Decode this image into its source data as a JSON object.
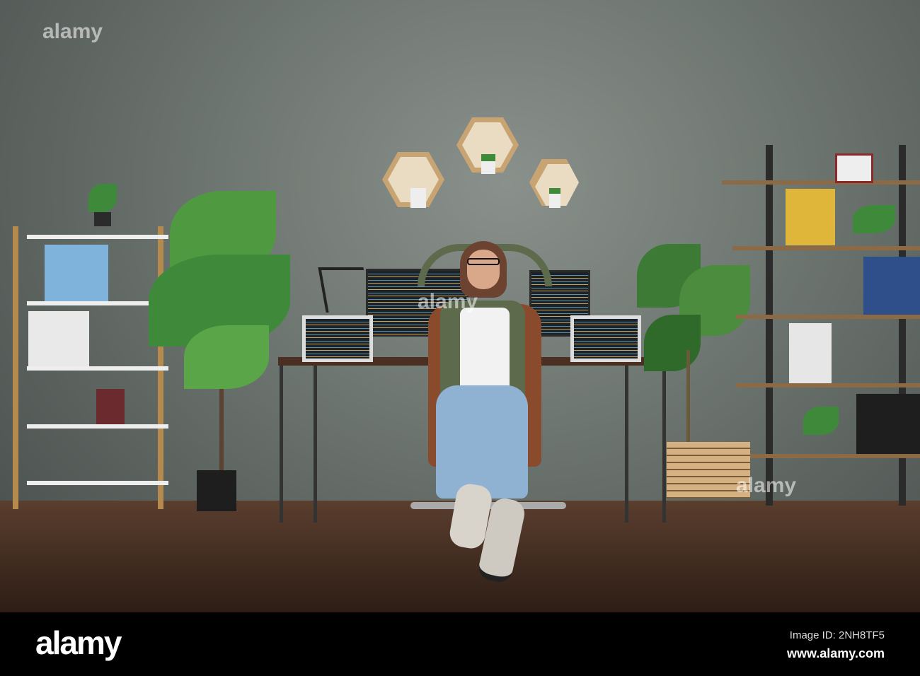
{
  "photo": {
    "description_alt": "Woman relaxing in office chair with hands behind head",
    "watermark": "alamy"
  },
  "footer": {
    "logo": "alamy",
    "image_id": "Image ID: 2NH8TF5",
    "url": "www.alamy.com"
  }
}
